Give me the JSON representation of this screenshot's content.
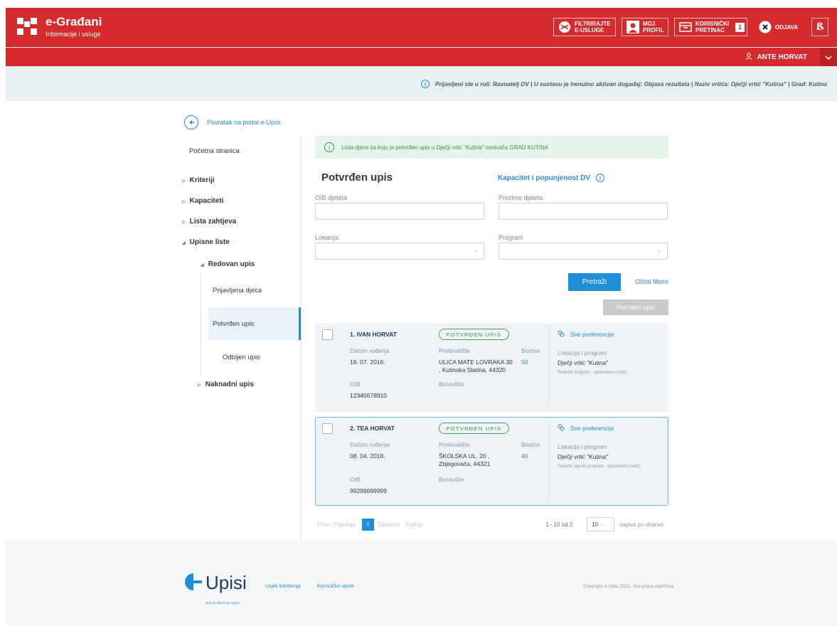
{
  "header": {
    "title": "e-Građani",
    "subtitle": "Informacije i usluge",
    "buttons": [
      {
        "label_line1": "FILTRIRAJTE",
        "label_line2": "E-USLUGE",
        "icon": "filter-services-icon"
      },
      {
        "label_line1": "MOJ",
        "label_line2": "PROFIL",
        "icon": "profile-icon"
      },
      {
        "label_line1": "KORISNIČKI",
        "label_line2": "PRETINAC",
        "icon": "inbox-icon",
        "count": "1"
      },
      {
        "label": "ODJAVA",
        "icon": "logout-icon"
      }
    ],
    "accent_glyph": "ß",
    "user_name": "ANTE HORVAT"
  },
  "info_bar": {
    "text": "Prijavljeni ste u roli: Ravnatelj DV | U sustavu je trenutno aktivan događaj: Objava rezultata | Naziv vrtića: Dječji vrtić \"Kutina\" | Grad: Kutina"
  },
  "sidebar": {
    "back_label": "Povratak na portal e-Upisi",
    "home": "Početna stranica",
    "items": [
      "Kriteriji",
      "Kapaciteti",
      "Lista zahtjeva",
      "Upisne liste"
    ],
    "regular": "Redovan upis",
    "sub_items": [
      "Prijavljena djeca",
      "Potvrđen upis",
      "Odbijen upis"
    ],
    "later": "Naknadni upis"
  },
  "main": {
    "success_msg": "Lista djece za koju je potvrđen upis u Dječji vrtić \"Kutina\" osnivača GRAD KUTINA",
    "title": "Potvrđen upis",
    "capacity_link": "Kapacitet i popunjenost DV",
    "filters": {
      "oib_label": "OIB djeteta",
      "oib_value": "",
      "surname_label": "Prezime djeteta",
      "surname_value": "",
      "location_label": "Lokacija",
      "location_value": "",
      "program_label": "Program",
      "program_value": ""
    },
    "search_btn": "Pretraži",
    "clear_link": "Očisti filtere",
    "move_btn": "Pomakni upis"
  },
  "cards": [
    {
      "name": "1. IVAN HORVAT",
      "status": "POTVRĐEN UPIS",
      "dob_label": "Datum rođenja",
      "dob": "19. 07. 2016.",
      "residence_label": "Prebivalište",
      "residence_line1": "ULICA MATE LOVRAKA 30",
      "residence_line2": ", Kutinska Slatina, 44320",
      "points_label": "Bodovi",
      "points": "50",
      "oib_label": "OIB",
      "oib": "12345678910",
      "stay_label": "Boravište",
      "pref_link": "Sve preferencije",
      "loc_prog_label": "Lokacija i program",
      "kindergarten": "Dječji vrtić \"Kutina\"",
      "program": "Redoviti program - cjelodnevni (vrtić)"
    },
    {
      "name": "2. TEA HORVAT",
      "status": "POTVRĐEN UPIS",
      "dob_label": "Datum rođenja",
      "dob": "08. 04. 2018.",
      "residence_label": "Prebivalište",
      "residence_line1": "ŠKOLSKA UL. 20 ,",
      "residence_line2": "Zbjegovača, 44321",
      "points_label": "Bodovi",
      "points": "40",
      "oib_label": "OIB",
      "oib": "99299699999",
      "stay_label": "Boravište",
      "pref_link": "Sve preferencije",
      "loc_prog_label": "Lokacija i program",
      "kindergarten": "Dječji vrtić \"Kutina\"",
      "program": "Posebni vjerski program - cjelodnevni (vrtić)"
    }
  ],
  "pagination": {
    "first": "Prva",
    "prev": "Prijašnja",
    "current": "1",
    "next": "Sljedeća",
    "last": "Zadnja",
    "range": "1 - 10 od 2",
    "per_page": "10",
    "per_page_label": "zapisa po stranici"
  },
  "footer": {
    "logo_text": "Upisi",
    "tagline": "Jednim klikom do upisa!",
    "links": [
      "Uvjeti korištenja",
      "Korisničke upute"
    ],
    "copyright": "Copyright e-Upisi 2021. Sva prava zadržana"
  },
  "colors": {
    "brand_red": "#d52b2d",
    "accent_blue": "#1f8ed8",
    "success_green": "#3a8e4b"
  }
}
